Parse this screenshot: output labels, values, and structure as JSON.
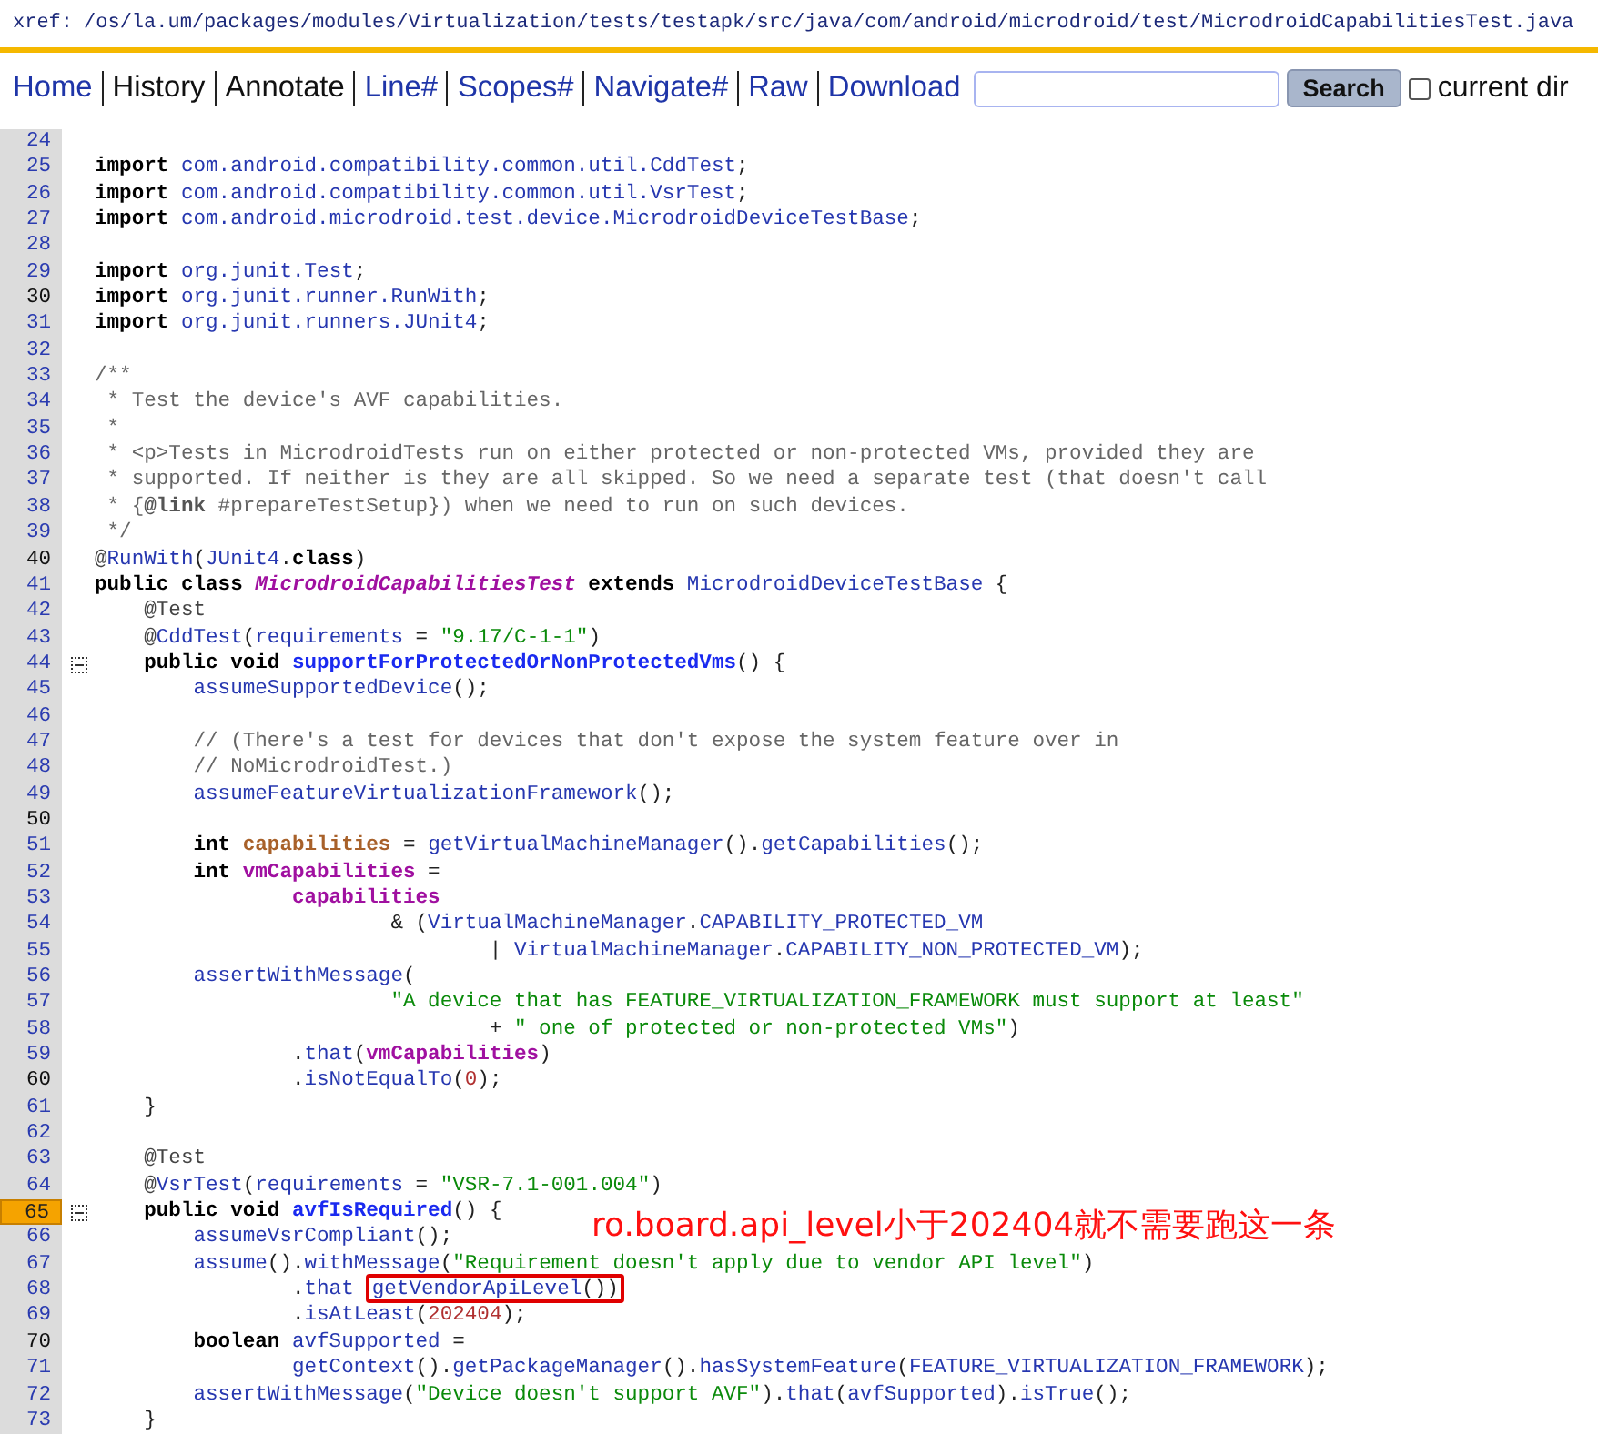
{
  "xref": {
    "label": "xref:",
    "path": [
      "/os",
      "/la.um",
      "/packages",
      "/modules",
      "/Virtualization",
      "/tests",
      "/testapk",
      "/src",
      "/java",
      "/com",
      "/android",
      "/microdroid",
      "/test",
      "/MicrodroidCapabilitiesTest.java"
    ]
  },
  "nav": {
    "items": [
      {
        "label": "Home",
        "kind": "link"
      },
      {
        "label": "History",
        "kind": "text"
      },
      {
        "label": "Annotate",
        "kind": "text"
      },
      {
        "label": "Line#",
        "kind": "link"
      },
      {
        "label": "Scopes#",
        "kind": "link"
      },
      {
        "label": "Navigate#",
        "kind": "link"
      },
      {
        "label": "Raw",
        "kind": "link"
      },
      {
        "label": "Download",
        "kind": "link"
      }
    ],
    "search": {
      "button": "Search"
    },
    "scope": {
      "label": "current dir",
      "checked": false
    }
  },
  "code": {
    "lines": [
      {
        "n": "24",
        "emphasized": false,
        "selected": false,
        "fold": false
      },
      {
        "n": "25",
        "emphasized": false,
        "selected": false,
        "fold": false,
        "tokens": [
          {
            "kind": "kw",
            "text": "import "
          },
          {
            "kind": "id",
            "text": "com.android.compatibility.common.util.CddTest"
          },
          {
            "kind": "p",
            "text": ";"
          }
        ]
      },
      {
        "n": "26",
        "emphasized": false,
        "selected": false,
        "fold": false,
        "tokens": [
          {
            "kind": "kw",
            "text": "import "
          },
          {
            "kind": "id",
            "text": "com.android.compatibility.common.util.VsrTest"
          },
          {
            "kind": "p",
            "text": ";"
          }
        ]
      },
      {
        "n": "27",
        "emphasized": false,
        "selected": false,
        "fold": false,
        "tokens": [
          {
            "kind": "kw",
            "text": "import "
          },
          {
            "kind": "id",
            "text": "com.android.microdroid.test.device.MicrodroidDeviceTestBase"
          },
          {
            "kind": "p",
            "text": ";"
          }
        ]
      },
      {
        "n": "28",
        "emphasized": false,
        "selected": false,
        "fold": false
      },
      {
        "n": "29",
        "emphasized": false,
        "selected": false,
        "fold": false,
        "tokens": [
          {
            "kind": "kw",
            "text": "import "
          },
          {
            "kind": "id",
            "text": "org.junit.Test"
          },
          {
            "kind": "p",
            "text": ";"
          }
        ]
      },
      {
        "n": "30",
        "emphasized": true,
        "selected": false,
        "fold": false,
        "tokens": [
          {
            "kind": "kw",
            "text": "import "
          },
          {
            "kind": "id",
            "text": "org.junit.runner.RunWith"
          },
          {
            "kind": "p",
            "text": ";"
          }
        ]
      },
      {
        "n": "31",
        "emphasized": false,
        "selected": false,
        "fold": false,
        "tokens": [
          {
            "kind": "kw",
            "text": "import "
          },
          {
            "kind": "id",
            "text": "org.junit.runners.JUnit4"
          },
          {
            "kind": "p",
            "text": ";"
          }
        ]
      },
      {
        "n": "32",
        "emphasized": false,
        "selected": false,
        "fold": false
      },
      {
        "n": "33",
        "emphasized": false,
        "selected": false,
        "fold": false,
        "tokens": [
          {
            "kind": "c",
            "text": "/**"
          }
        ]
      },
      {
        "n": "34",
        "emphasized": false,
        "selected": false,
        "fold": false,
        "tokens": [
          {
            "kind": "c",
            "text": " * Test the device's AVF capabilities."
          }
        ]
      },
      {
        "n": "35",
        "emphasized": false,
        "selected": false,
        "fold": false,
        "tokens": [
          {
            "kind": "c",
            "text": " *"
          }
        ]
      },
      {
        "n": "36",
        "emphasized": false,
        "selected": false,
        "fold": false,
        "tokens": [
          {
            "kind": "c",
            "text": " * <p>Tests in MicrodroidTests run on either protected or non-protected VMs, provided they are"
          }
        ]
      },
      {
        "n": "37",
        "emphasized": false,
        "selected": false,
        "fold": false,
        "tokens": [
          {
            "kind": "c",
            "text": " * supported. If neither is they are all skipped. So we need a separate test (that doesn't call"
          }
        ]
      },
      {
        "n": "38",
        "emphasized": false,
        "selected": false,
        "fold": false,
        "tokens": [
          {
            "kind": "c",
            "text": " * {"
          },
          {
            "kind": "ctag",
            "text": "@link"
          },
          {
            "kind": "c",
            "text": " #prepareTestSetup}) when we need to run on such devices."
          }
        ]
      },
      {
        "n": "39",
        "emphasized": false,
        "selected": false,
        "fold": false,
        "tokens": [
          {
            "kind": "c",
            "text": " */"
          }
        ]
      },
      {
        "n": "40",
        "emphasized": true,
        "selected": false,
        "fold": false,
        "tokens": [
          {
            "kind": "at",
            "text": "@"
          },
          {
            "kind": "id",
            "text": "RunWith"
          },
          {
            "kind": "p",
            "text": "("
          },
          {
            "kind": "id",
            "text": "JUnit4"
          },
          {
            "kind": "p",
            "text": "."
          },
          {
            "kind": "kw",
            "text": "class"
          },
          {
            "kind": "p",
            "text": ")"
          }
        ]
      },
      {
        "n": "41",
        "emphasized": false,
        "selected": false,
        "fold": false,
        "tokens": [
          {
            "kind": "kw",
            "text": "public class "
          },
          {
            "kind": "cls",
            "text": "MicrodroidCapabilitiesTest"
          },
          {
            "kind": "kw",
            "text": " extends "
          },
          {
            "kind": "id",
            "text": "MicrodroidDeviceTestBase"
          },
          {
            "kind": "p",
            "text": " {"
          }
        ]
      },
      {
        "n": "42",
        "emphasized": false,
        "selected": false,
        "fold": false,
        "tokens": [
          {
            "kind": "at",
            "text": "    @Test"
          }
        ]
      },
      {
        "n": "43",
        "emphasized": false,
        "selected": false,
        "fold": false,
        "tokens": [
          {
            "kind": "at",
            "text": "    @"
          },
          {
            "kind": "id",
            "text": "CddTest"
          },
          {
            "kind": "p",
            "text": "("
          },
          {
            "kind": "id",
            "text": "requirements"
          },
          {
            "kind": "p",
            "text": " = "
          },
          {
            "kind": "s",
            "text": "\"9.17/C-1-1\""
          },
          {
            "kind": "p",
            "text": ")"
          }
        ]
      },
      {
        "n": "44",
        "emphasized": false,
        "selected": false,
        "fold": true,
        "tokens": [
          {
            "kind": "kw",
            "text": "    public void "
          },
          {
            "kind": "mdef",
            "text": "supportForProtectedOrNonProtectedVms"
          },
          {
            "kind": "p",
            "text": "() {"
          }
        ]
      },
      {
        "n": "45",
        "emphasized": false,
        "selected": false,
        "fold": false,
        "tokens": [
          {
            "kind": "id",
            "text": "        assumeSupportedDevice"
          },
          {
            "kind": "p",
            "text": "();"
          }
        ]
      },
      {
        "n": "46",
        "emphasized": false,
        "selected": false,
        "fold": false
      },
      {
        "n": "47",
        "emphasized": false,
        "selected": false,
        "fold": false,
        "tokens": [
          {
            "kind": "c",
            "text": "        // (There's a test for devices that don't expose the system feature over in"
          }
        ]
      },
      {
        "n": "48",
        "emphasized": false,
        "selected": false,
        "fold": false,
        "tokens": [
          {
            "kind": "c",
            "text": "        // NoMicrodroidTest.)"
          }
        ]
      },
      {
        "n": "49",
        "emphasized": false,
        "selected": false,
        "fold": false,
        "tokens": [
          {
            "kind": "id",
            "text": "        assumeFeatureVirtualizationFramework"
          },
          {
            "kind": "p",
            "text": "();"
          }
        ]
      },
      {
        "n": "50",
        "emphasized": true,
        "selected": false,
        "fold": false
      },
      {
        "n": "51",
        "emphasized": false,
        "selected": false,
        "fold": false,
        "tokens": [
          {
            "kind": "kw",
            "text": "        int "
          },
          {
            "kind": "fld",
            "text": "capabilities"
          },
          {
            "kind": "p",
            "text": " = "
          },
          {
            "kind": "id",
            "text": "getVirtualMachineManager"
          },
          {
            "kind": "p",
            "text": "()."
          },
          {
            "kind": "id",
            "text": "getCapabilities"
          },
          {
            "kind": "p",
            "text": "();"
          }
        ]
      },
      {
        "n": "52",
        "emphasized": false,
        "selected": false,
        "fold": false,
        "tokens": [
          {
            "kind": "kw",
            "text": "        int "
          },
          {
            "kind": "loc",
            "text": "vmCapabilities"
          },
          {
            "kind": "p",
            "text": " ="
          }
        ]
      },
      {
        "n": "53",
        "emphasized": false,
        "selected": false,
        "fold": false,
        "tokens": [
          {
            "kind": "loc",
            "text": "                capabilities"
          }
        ]
      },
      {
        "n": "54",
        "emphasized": false,
        "selected": false,
        "fold": false,
        "tokens": [
          {
            "kind": "p",
            "text": "                        & ("
          },
          {
            "kind": "id",
            "text": "VirtualMachineManager"
          },
          {
            "kind": "p",
            "text": "."
          },
          {
            "kind": "id",
            "text": "CAPABILITY_PROTECTED_VM"
          }
        ]
      },
      {
        "n": "55",
        "emphasized": false,
        "selected": false,
        "fold": false,
        "tokens": [
          {
            "kind": "p",
            "text": "                                | "
          },
          {
            "kind": "id",
            "text": "VirtualMachineManager"
          },
          {
            "kind": "p",
            "text": "."
          },
          {
            "kind": "id",
            "text": "CAPABILITY_NON_PROTECTED_VM"
          },
          {
            "kind": "p",
            "text": ");"
          }
        ]
      },
      {
        "n": "56",
        "emphasized": false,
        "selected": false,
        "fold": false,
        "tokens": [
          {
            "kind": "id",
            "text": "        assertWithMessage"
          },
          {
            "kind": "p",
            "text": "("
          }
        ]
      },
      {
        "n": "57",
        "emphasized": false,
        "selected": false,
        "fold": false,
        "tokens": [
          {
            "kind": "s",
            "text": "                        \"A device that has FEATURE_VIRTUALIZATION_FRAMEWORK must support at least\""
          }
        ]
      },
      {
        "n": "58",
        "emphasized": false,
        "selected": false,
        "fold": false,
        "tokens": [
          {
            "kind": "p",
            "text": "                                + "
          },
          {
            "kind": "s",
            "text": "\" one of protected or non-protected VMs\""
          },
          {
            "kind": "p",
            "text": ")"
          }
        ]
      },
      {
        "n": "59",
        "emphasized": false,
        "selected": false,
        "fold": false,
        "tokens": [
          {
            "kind": "p",
            "text": "                ."
          },
          {
            "kind": "id",
            "text": "that"
          },
          {
            "kind": "p",
            "text": "("
          },
          {
            "kind": "loc",
            "text": "vmCapabilities"
          },
          {
            "kind": "p",
            "text": ")"
          }
        ]
      },
      {
        "n": "60",
        "emphasized": true,
        "selected": false,
        "fold": false,
        "tokens": [
          {
            "kind": "p",
            "text": "                ."
          },
          {
            "kind": "id",
            "text": "isNotEqualTo"
          },
          {
            "kind": "p",
            "text": "("
          },
          {
            "kind": "n",
            "text": "0"
          },
          {
            "kind": "p",
            "text": ");"
          }
        ]
      },
      {
        "n": "61",
        "emphasized": false,
        "selected": false,
        "fold": false,
        "tokens": [
          {
            "kind": "p",
            "text": "    }"
          }
        ]
      },
      {
        "n": "62",
        "emphasized": false,
        "selected": false,
        "fold": false
      },
      {
        "n": "63",
        "emphasized": false,
        "selected": false,
        "fold": false,
        "tokens": [
          {
            "kind": "at",
            "text": "    @Test"
          }
        ]
      },
      {
        "n": "64",
        "emphasized": false,
        "selected": false,
        "fold": false,
        "tokens": [
          {
            "kind": "at",
            "text": "    @"
          },
          {
            "kind": "id",
            "text": "VsrTest"
          },
          {
            "kind": "p",
            "text": "("
          },
          {
            "kind": "id",
            "text": "requirements"
          },
          {
            "kind": "p",
            "text": " = "
          },
          {
            "kind": "s",
            "text": "\"VSR-7.1-001.004\""
          },
          {
            "kind": "p",
            "text": ")"
          }
        ]
      },
      {
        "n": "65",
        "emphasized": false,
        "selected": true,
        "fold": true,
        "tokens": [
          {
            "kind": "kw",
            "text": "    public void "
          },
          {
            "kind": "mdef",
            "text": "avfIsRequired"
          },
          {
            "kind": "p",
            "text": "() {"
          }
        ]
      },
      {
        "n": "66",
        "emphasized": false,
        "selected": false,
        "fold": false,
        "tokens": [
          {
            "kind": "id",
            "text": "        assumeVsrCompliant"
          },
          {
            "kind": "p",
            "text": "();"
          }
        ]
      },
      {
        "n": "67",
        "emphasized": false,
        "selected": false,
        "fold": false,
        "tokens": [
          {
            "kind": "id",
            "text": "        assume"
          },
          {
            "kind": "p",
            "text": "()."
          },
          {
            "kind": "id",
            "text": "withMessage"
          },
          {
            "kind": "p",
            "text": "("
          },
          {
            "kind": "s",
            "text": "\"Requirement doesn't apply due to vendor API level\""
          },
          {
            "kind": "p",
            "text": ")"
          }
        ]
      },
      {
        "n": "68",
        "emphasized": false,
        "selected": false,
        "fold": false,
        "tokens": [
          {
            "kind": "p",
            "text": "                ."
          },
          {
            "kind": "id",
            "text": "that"
          },
          {
            "kind": "id",
            "text": "getVendorApiLevel",
            "boxed": true
          },
          {
            "kind": "p",
            "text": "())",
            "boxed": true
          }
        ]
      },
      {
        "n": "69",
        "emphasized": false,
        "selected": false,
        "fold": false,
        "tokens": [
          {
            "kind": "p",
            "text": "                ."
          },
          {
            "kind": "id",
            "text": "isAtLeast"
          },
          {
            "kind": "p",
            "text": "("
          },
          {
            "kind": "n",
            "text": "202404"
          },
          {
            "kind": "p",
            "text": ");"
          }
        ]
      },
      {
        "n": "70",
        "emphasized": true,
        "selected": false,
        "fold": false,
        "tokens": [
          {
            "kind": "kw",
            "text": "        boolean "
          },
          {
            "kind": "id",
            "text": "avfSupported"
          },
          {
            "kind": "p",
            "text": " ="
          }
        ]
      },
      {
        "n": "71",
        "emphasized": false,
        "selected": false,
        "fold": false,
        "tokens": [
          {
            "kind": "id",
            "text": "                getContext"
          },
          {
            "kind": "p",
            "text": "()."
          },
          {
            "kind": "id",
            "text": "getPackageManager"
          },
          {
            "kind": "p",
            "text": "()."
          },
          {
            "kind": "id",
            "text": "hasSystemFeature"
          },
          {
            "kind": "p",
            "text": "("
          },
          {
            "kind": "id",
            "text": "FEATURE_VIRTUALIZATION_FRAMEWORK"
          },
          {
            "kind": "p",
            "text": ");"
          }
        ]
      },
      {
        "n": "72",
        "emphasized": false,
        "selected": false,
        "fold": false,
        "tokens": [
          {
            "kind": "id",
            "text": "        assertWithMessage"
          },
          {
            "kind": "p",
            "text": "("
          },
          {
            "kind": "s",
            "text": "\"Device doesn't support AVF\""
          },
          {
            "kind": "p",
            "text": ")."
          },
          {
            "kind": "id",
            "text": "that"
          },
          {
            "kind": "p",
            "text": "("
          },
          {
            "kind": "id",
            "text": "avfSupported"
          },
          {
            "kind": "p",
            "text": ")."
          },
          {
            "kind": "id",
            "text": "isTrue"
          },
          {
            "kind": "p",
            "text": "();"
          }
        ]
      },
      {
        "n": "73",
        "emphasized": false,
        "selected": false,
        "fold": false,
        "tokens": [
          {
            "kind": "p",
            "text": "    }"
          }
        ]
      }
    ],
    "note": "ro.board.api_level小于202404就不需要跑这一条"
  }
}
